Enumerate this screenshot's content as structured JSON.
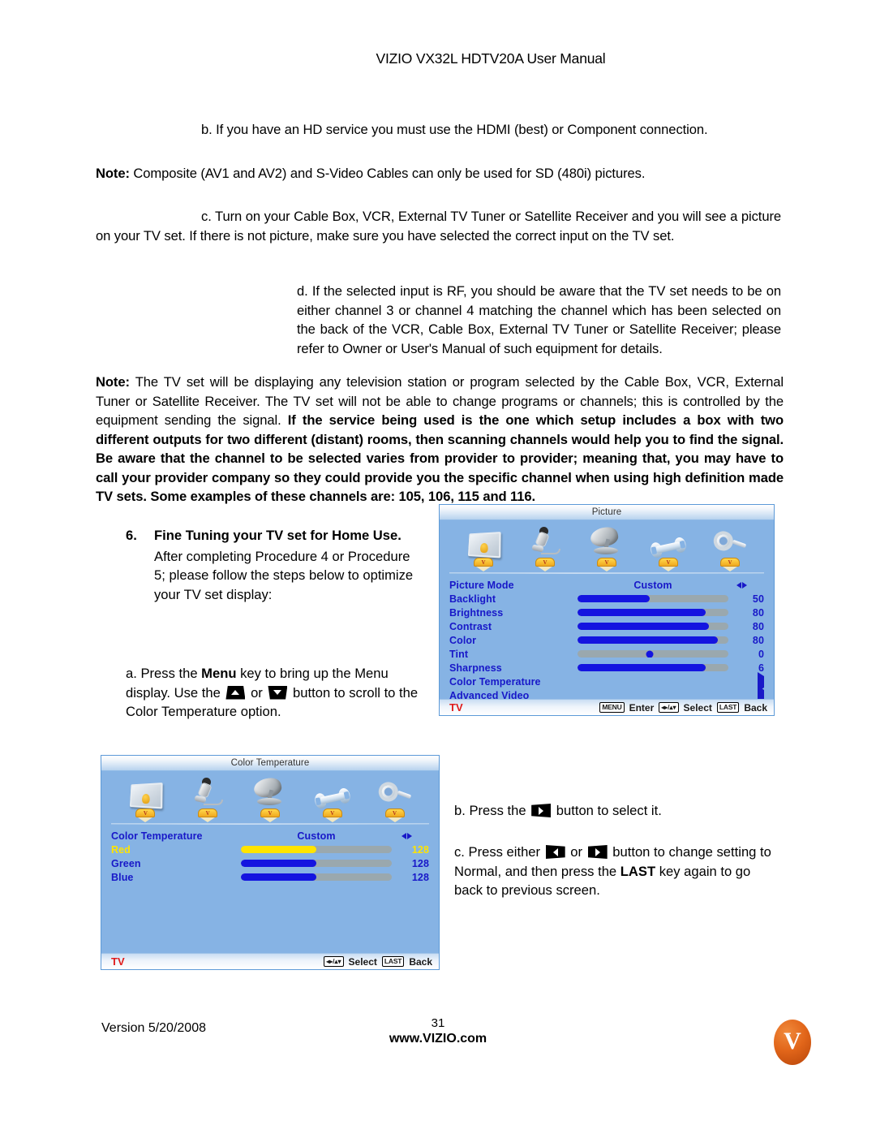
{
  "header": {
    "title": "VIZIO VX32L HDTV20A User Manual"
  },
  "body": {
    "para_b": "b. If you have an HD service you must use the HDMI (best) or Component connection.",
    "note_1_label": "Note:",
    "note_1_text": "Composite (AV1 and AV2) and S-Video Cables can only be used for SD (480i) pictures.",
    "para_c": "c. Turn on your Cable Box, VCR, External TV Tuner or Satellite Receiver and you will see a picture on your TV set. If there is not picture, make sure you have selected the correct input on the TV set.",
    "para_d": "d. If the selected input is RF, you should be aware that the TV set needs to be on either channel 3 or channel 4 matching the channel which has been selected on the back of the VCR, Cable Box, External TV Tuner or Satellite Receiver; please refer to Owner or User's Manual of such equipment for details.",
    "note_2_label": "Note:",
    "note_2_regular": "The TV set will be displaying any television station or program selected by the Cable Box, VCR, External Tuner or Satellite Receiver. The TV set will not be able to change programs or channels; this is controlled by the equipment sending the signal.",
    "note_2_bold": "If the service being used is the one which setup includes a box with two different outputs for two different (distant) rooms, then scanning channels would help you to find the signal. Be aware that the channel to be selected varies from provider to provider; meaning that, you may have to call your provider company so they could provide you the specific channel when using high definition made TV sets. Some examples of these channels are: 105, 106, 115 and 116."
  },
  "step6": {
    "number": "6.",
    "heading": "Fine Tuning your TV set for Home Use.",
    "text": "After completing Procedure 4 or Procedure 5; please follow the steps below to optimize your TV set display:"
  },
  "step_a": {
    "part1": "a. Press the ",
    "menu_key": "Menu",
    "part2": " key to bring up the Menu display. Use the ",
    "or": " or ",
    "part3": " button to scroll to the Color Temperature option."
  },
  "step_b": {
    "part1": "b. Press the ",
    "part2": " button to select it."
  },
  "step_c": {
    "part1": "c. Press either ",
    "or": " or ",
    "part2": " button to change setting to Normal, and then press the ",
    "last_key": "LAST",
    "part3": " key again to go back to previous screen."
  },
  "osd_icons": [
    {
      "name": "picture-icon",
      "label": "Picture"
    },
    {
      "name": "audio-icon",
      "label": "Audio"
    },
    {
      "name": "tuner-setup-icon",
      "label": "TV"
    },
    {
      "name": "setup-wrench-icon",
      "label": "Setup"
    },
    {
      "name": "parental-key-icon",
      "label": "Parental"
    }
  ],
  "picture_menu": {
    "title": "Picture",
    "rows": [
      {
        "label": "Picture Mode",
        "type": "mode",
        "value": "Custom",
        "control": "lr"
      },
      {
        "label": "Backlight",
        "type": "slider",
        "value": "50",
        "fill": 48
      },
      {
        "label": "Brightness",
        "type": "slider",
        "value": "80",
        "fill": 85
      },
      {
        "label": "Contrast",
        "type": "slider",
        "value": "80",
        "fill": 87
      },
      {
        "label": "Color",
        "type": "slider",
        "value": "80",
        "fill": 93
      },
      {
        "label": "Tint",
        "type": "knob",
        "value": "0",
        "fill": 48
      },
      {
        "label": "Sharpness",
        "type": "slider",
        "value": "6",
        "fill": 85
      },
      {
        "label": "Color Temperature",
        "type": "arrow",
        "value": ""
      },
      {
        "label": "Advanced Video",
        "type": "arrow",
        "value": ""
      }
    ],
    "footer": {
      "source": "TV",
      "menu_key": "MENU",
      "enter_label": "Enter",
      "select_label": "Select",
      "last_key": "LAST",
      "back_label": "Back"
    }
  },
  "color_temp_menu": {
    "title": "Color Temperature",
    "rows": [
      {
        "label": "Color Temperature",
        "type": "mode",
        "value": "Custom",
        "control": "lr",
        "highlight": false
      },
      {
        "label": "Red",
        "type": "slider",
        "value": "128",
        "fill": 50,
        "highlight": true
      },
      {
        "label": "Green",
        "type": "slider",
        "value": "128",
        "fill": 50,
        "highlight": false
      },
      {
        "label": "Blue",
        "type": "slider",
        "value": "128",
        "fill": 50,
        "highlight": false
      }
    ],
    "footer": {
      "source": "TV",
      "select_label": "Select",
      "last_key": "LAST",
      "back_label": "Back"
    }
  },
  "footer": {
    "version": "Version 5/20/2008",
    "page_number": "31",
    "url": "www.VIZIO.com",
    "logo_letter": "V"
  },
  "colors": {
    "osd_background": "#86b3e4",
    "osd_label": "#1818c8",
    "osd_highlight": "#ffe400",
    "slider_fill": "#1414e0",
    "slider_track": "#9aa8ae",
    "source_red": "#e01b1b",
    "brand_orange": "#e2661a"
  }
}
